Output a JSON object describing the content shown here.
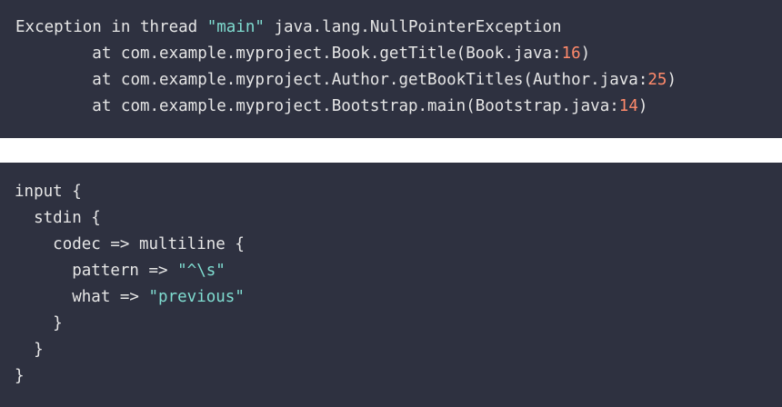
{
  "stack_trace": {
    "lines": [
      {
        "indent": "",
        "segments": [
          {
            "text": "Exception in thread ",
            "kind": "plain"
          },
          {
            "text": "\"main\"",
            "kind": "str"
          },
          {
            "text": " java.lang.NullPointerException",
            "kind": "plain"
          }
        ]
      },
      {
        "indent": "        ",
        "segments": [
          {
            "text": "at com.example.myproject.Book.getTitle(Book.java:",
            "kind": "plain"
          },
          {
            "text": "16",
            "kind": "num"
          },
          {
            "text": ")",
            "kind": "plain"
          }
        ]
      },
      {
        "indent": "        ",
        "segments": [
          {
            "text": "at com.example.myproject.Author.getBookTitles(Author.java:",
            "kind": "plain"
          },
          {
            "text": "25",
            "kind": "num"
          },
          {
            "text": ")",
            "kind": "plain"
          }
        ]
      },
      {
        "indent": "        ",
        "segments": [
          {
            "text": "at com.example.myproject.Bootstrap.main(Bootstrap.java:",
            "kind": "plain"
          },
          {
            "text": "14",
            "kind": "num"
          },
          {
            "text": ")",
            "kind": "plain"
          }
        ]
      }
    ]
  },
  "config": {
    "lines": [
      {
        "indent": "",
        "segments": [
          {
            "text": "input {",
            "kind": "plain"
          }
        ]
      },
      {
        "indent": "  ",
        "segments": [
          {
            "text": "stdin {",
            "kind": "plain"
          }
        ]
      },
      {
        "indent": "    ",
        "segments": [
          {
            "text": "codec => multiline {",
            "kind": "plain"
          }
        ]
      },
      {
        "indent": "      ",
        "segments": [
          {
            "text": "pattern => ",
            "kind": "plain"
          },
          {
            "text": "\"^\\s\"",
            "kind": "str"
          }
        ]
      },
      {
        "indent": "      ",
        "segments": [
          {
            "text": "what => ",
            "kind": "plain"
          },
          {
            "text": "\"previous\"",
            "kind": "str"
          }
        ]
      },
      {
        "indent": "    ",
        "segments": [
          {
            "text": "}",
            "kind": "plain"
          }
        ]
      },
      {
        "indent": "  ",
        "segments": [
          {
            "text": "}",
            "kind": "plain"
          }
        ]
      },
      {
        "indent": "",
        "segments": [
          {
            "text": "}",
            "kind": "plain"
          }
        ]
      }
    ]
  },
  "colors": {
    "background": "#2e3140",
    "plain_text": "#e6e6e6",
    "string": "#7fdcd0",
    "number": "#ff8a6b"
  }
}
